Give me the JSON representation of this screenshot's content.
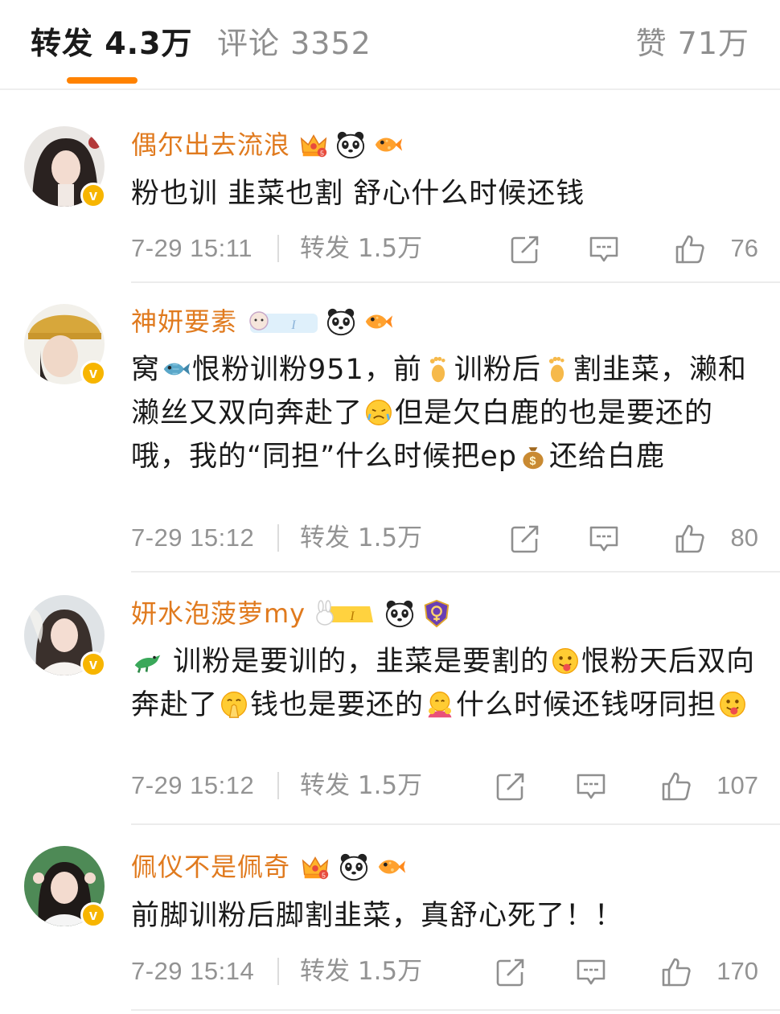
{
  "tabs": {
    "repost": "转发 4.3万",
    "comment": "评论 3352",
    "like": "赞 71万"
  },
  "colors": {
    "accent": "#ff8200",
    "username": "#e07a1e",
    "meta": "#939393",
    "verified_badge": "#f7b500"
  },
  "comments": [
    {
      "username": "偶尔出去流浪",
      "badges": [
        "crown-badge",
        "panda-badge",
        "fish-badge"
      ],
      "text_parts": [
        "粉也训 韭菜也割  舒心什么时候还钱"
      ],
      "time": "7-29 15:11",
      "repost": "转发 1.5万",
      "likes": "76"
    },
    {
      "username": "神妍要素",
      "badges": [
        "fan-card-badge",
        "panda-badge",
        "fish-badge"
      ],
      "text_parts": [
        "窝",
        "恨粉训粉951，前",
        "训粉后",
        "割韭菜，濑和濑丝又双向奔赴了",
        "但是欠白鹿的也是要还的哦，我的“同担”什么时候把ep",
        "还给白鹿"
      ],
      "emojis": [
        "fish-emoji",
        "foot-emoji",
        "foot-emoji",
        "crying-emoji",
        "money-bag-emoji"
      ],
      "time": "7-29 15:12",
      "repost": "转发 1.5万",
      "likes": "80"
    },
    {
      "username": "妍水泡菠萝my",
      "badges": [
        "rabbit-fan-badge",
        "panda-badge",
        "shield-badge"
      ],
      "text_parts": [
        "",
        " 训粉是要训的，韭菜是要割的",
        "恨粉天后双向奔赴了",
        "钱也是要还的",
        "什么时候还钱呀同担",
        ""
      ],
      "emojis": [
        "crocodile-emoji",
        "tongue-emoji",
        "pray-emoji",
        "hug-emoji",
        "tongue-emoji"
      ],
      "time": "7-29 15:12",
      "repost": "转发 1.5万",
      "likes": "107"
    },
    {
      "username": "佩仪不是佩奇",
      "badges": [
        "crown-badge",
        "panda-badge",
        "fish-badge"
      ],
      "text_parts": [
        "前脚训粉后脚割韭菜，真舒心死了！！"
      ],
      "time": "7-29 15:14",
      "repost": "转发 1.5万",
      "likes": "170"
    }
  ]
}
